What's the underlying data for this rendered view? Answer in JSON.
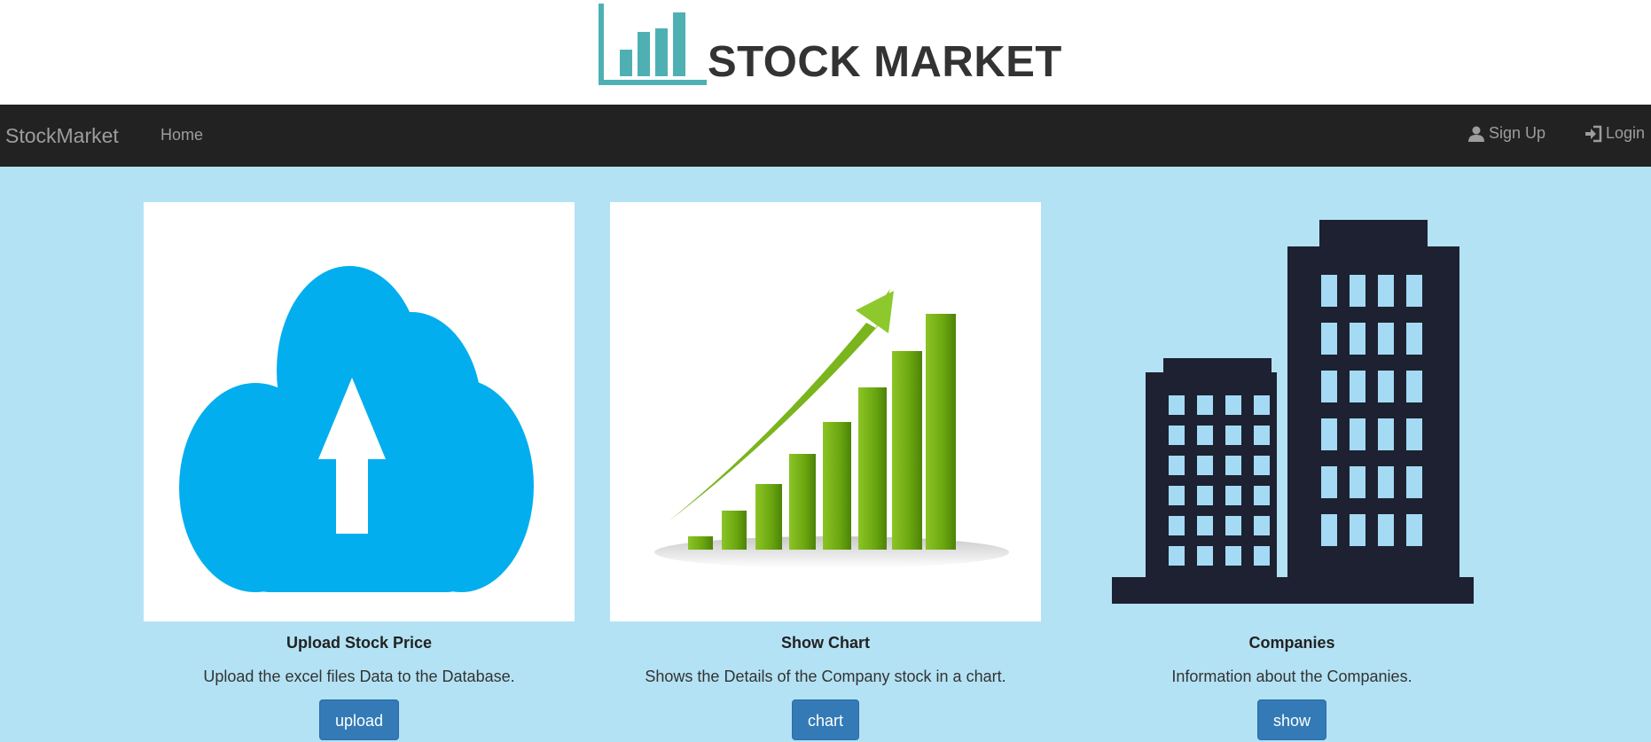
{
  "header": {
    "logo_icon": "bar-chart-logo-icon",
    "logo_color": "#4fb0b4",
    "title": "STOCK MARKET"
  },
  "navbar": {
    "brand": "StockMarket",
    "home": "Home",
    "signup": "Sign Up",
    "signup_icon": "user-icon",
    "login": "Login",
    "login_icon": "login-icon",
    "background": "#222222"
  },
  "main": {
    "background": "#b3e2f4",
    "cards": [
      {
        "icon": "cloud-upload-icon",
        "title": "Upload Stock Price",
        "description": "Upload the excel files Data to the Database.",
        "button": "upload"
      },
      {
        "icon": "growth-chart-icon",
        "title": "Show Chart",
        "description": "Shows the Details of the Company stock in a chart.",
        "button": "chart"
      },
      {
        "icon": "buildings-icon",
        "title": "Companies",
        "description": "Information about the Companies.",
        "button": "show"
      }
    ],
    "button_color": "#337ab7"
  }
}
